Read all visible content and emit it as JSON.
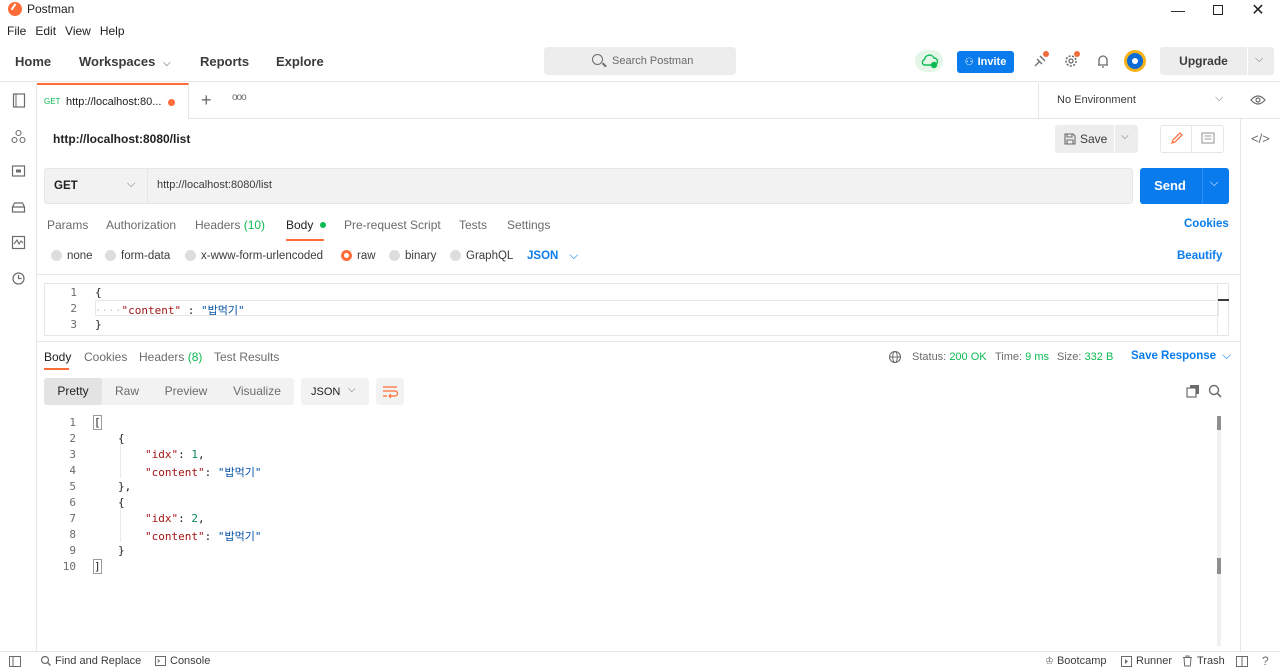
{
  "window": {
    "title": "Postman",
    "controls": [
      "minimize",
      "maximize",
      "close"
    ]
  },
  "menu": [
    "File",
    "Edit",
    "View",
    "Help"
  ],
  "header": {
    "nav": [
      "Home",
      "Workspaces",
      "Reports",
      "Explore"
    ],
    "search_placeholder": "Search Postman",
    "invite_label": "Invite",
    "upgrade_label": "Upgrade"
  },
  "tab": {
    "method": "GET",
    "title": "http://localhost:80...",
    "unsaved": true
  },
  "environment": "No Environment",
  "request": {
    "name": "http://localhost:8080/list",
    "save_label": "Save",
    "method": "GET",
    "url": "http://localhost:8080/list",
    "send_label": "Send",
    "tabs": {
      "params": "Params",
      "authorization": "Authorization",
      "headers": "Headers",
      "headers_count": "(10)",
      "body": "Body",
      "prerequest": "Pre-request Script",
      "tests": "Tests",
      "settings": "Settings"
    },
    "cookies_link": "Cookies",
    "body_types": {
      "none": "none",
      "form_data": "form-data",
      "urlencoded": "x-www-form-urlencoded",
      "raw": "raw",
      "binary": "binary",
      "graphql": "GraphQL",
      "selected": "raw"
    },
    "body_language": "JSON",
    "beautify": "Beautify",
    "body_lines": {
      "l1": "{",
      "l2_key": "\"content\"",
      "l2_sep": " : ",
      "l2_val": "\"밥먹기\"",
      "l3": "}"
    }
  },
  "response": {
    "tabs": {
      "body": "Body",
      "cookies": "Cookies",
      "headers": "Headers",
      "headers_count": "(8)",
      "tests": "Test Results"
    },
    "status_label": "Status:",
    "status_value": "200 OK",
    "time_label": "Time:",
    "time_value": "9 ms",
    "size_label": "Size:",
    "size_value": "332 B",
    "save_response": "Save Response",
    "views": [
      "Pretty",
      "Raw",
      "Preview",
      "Visualize"
    ],
    "language": "JSON",
    "items": [
      {
        "idx": 1,
        "content": "밥먹기"
      },
      {
        "idx": 2,
        "content": "밥먹기"
      }
    ]
  },
  "footer": {
    "find_replace": "Find and Replace",
    "console": "Console",
    "bootcamp": "Bootcamp",
    "runner": "Runner",
    "trash": "Trash"
  },
  "colors": {
    "accent": "#ff6c37",
    "primary": "#097bed",
    "success": "#0cbb52"
  }
}
